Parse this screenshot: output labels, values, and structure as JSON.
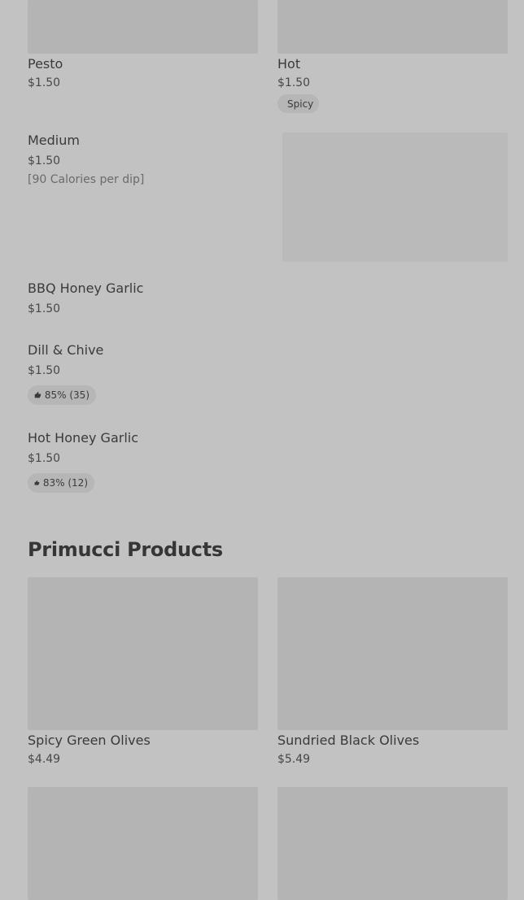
{
  "dips_top": {
    "pesto": {
      "name": "Pesto",
      "price": "$1.50"
    },
    "hot": {
      "name": "Hot",
      "price": "$1.50",
      "tag": "Spicy"
    }
  },
  "dips": [
    {
      "name": "Medium",
      "price": "$1.50",
      "note": "[90 Calories per dip]"
    },
    {
      "name": "BBQ Honey Garlic",
      "price": "$1.50"
    },
    {
      "name": "Dill & Chive",
      "price": "$1.50",
      "rating": "85% (35)"
    },
    {
      "name": "Hot Honey Garlic",
      "price": "$1.50",
      "rating": "83% (12)"
    }
  ],
  "primucci": {
    "title": "Primucci Products",
    "items": [
      {
        "name": "Spicy Green Olives",
        "price": "$4.49"
      },
      {
        "name": "Sundried Black Olives",
        "price": "$5.49"
      }
    ]
  },
  "icons": {
    "rating": "thumbs-up-icon"
  },
  "colors": {
    "background": "#c2c2c2",
    "placeholder": "#b4b4b4",
    "pill": "#b6b6b6",
    "text": "#3e3e3e"
  }
}
